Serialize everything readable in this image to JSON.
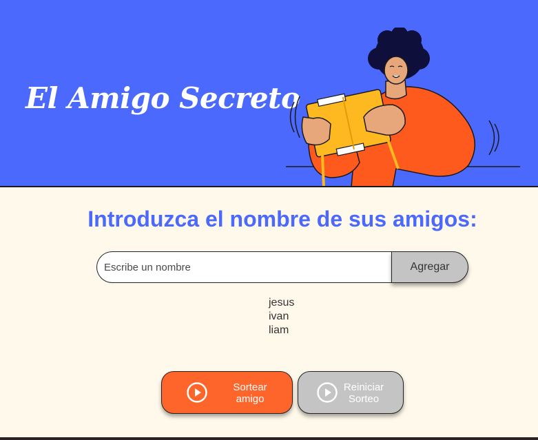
{
  "header": {
    "title": "El Amigo Secreto",
    "illustration_icon": "person-holding-gift-box-illustration"
  },
  "main": {
    "subtitle": "Introduzca el nombre de sus amigos:",
    "name_input": {
      "placeholder": "Escribe un nombre",
      "value": ""
    },
    "add_button_label": "Agregar",
    "friends": [
      "jesus",
      "ivan",
      "liam"
    ],
    "draw_button": {
      "label_line1": "Sortear",
      "label_line2": "amigo",
      "icon": "play-circle-icon"
    },
    "reset_button": {
      "label_line1": "Reiniciar",
      "label_line2": "Sorteo",
      "icon": "play-circle-icon"
    }
  },
  "colors": {
    "header_background": "#4B69FD",
    "page_background": "#FFF9EB",
    "accent_blue": "#4B69FD",
    "draw_button": "#FE652B",
    "gray_button": "#C4C4C4"
  }
}
